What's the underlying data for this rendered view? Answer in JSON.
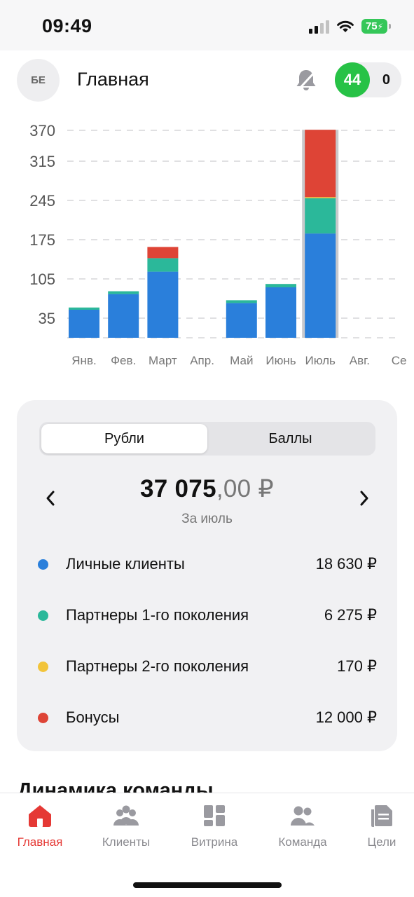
{
  "status_bar": {
    "time": "09:49",
    "battery": "75"
  },
  "header": {
    "avatar_initials": "БЕ",
    "title": "Главная",
    "counter_green": "44",
    "counter_gray": "0"
  },
  "colors": {
    "personal": "#2a7fdb",
    "partners1": "#2bb89a",
    "partners2": "#f2c43a",
    "bonus": "#de4436",
    "active_tab": "#e53935",
    "badge_green": "#27c246"
  },
  "chart_data": {
    "type": "bar",
    "stacked": true,
    "categories": [
      "Янв.",
      "Фев.",
      "Март",
      "Апр.",
      "Май",
      "Июнь",
      "Июль",
      "Авг.",
      "Се"
    ],
    "series": [
      {
        "name": "Личные клиенты",
        "color": "#2a7fdb",
        "values": [
          50,
          78,
          118,
          0,
          62,
          90,
          186,
          0,
          0
        ]
      },
      {
        "name": "Партнеры 1-го поколения",
        "color": "#2bb89a",
        "values": [
          4,
          5,
          24,
          0,
          5,
          6,
          63,
          0,
          0
        ]
      },
      {
        "name": "Партнеры 2-го поколения",
        "color": "#f2c43a",
        "values": [
          0,
          0,
          0,
          0,
          0,
          0,
          2,
          0,
          0
        ]
      },
      {
        "name": "Бонусы",
        "color": "#de4436",
        "values": [
          0,
          0,
          20,
          0,
          0,
          0,
          120,
          0,
          0
        ]
      }
    ],
    "yticks": [
      35,
      105,
      175,
      245,
      315,
      370
    ],
    "ylim": [
      0,
      370
    ],
    "selected_category": "Июль",
    "grid": true
  },
  "summary": {
    "tabs": [
      "Рубли",
      "Баллы"
    ],
    "active_tab": "Рубли",
    "amount_int": "37 075",
    "amount_frac": ",00 ₽",
    "period": "За июль",
    "items": [
      {
        "label": "Личные клиенты",
        "value": "18 630 ₽",
        "color": "#2a7fdb"
      },
      {
        "label": "Партнеры 1-го поколения",
        "value": "6 275 ₽",
        "color": "#2bb89a"
      },
      {
        "label": "Партнеры 2-го поколения",
        "value": "170 ₽",
        "color": "#f2c43a"
      },
      {
        "label": "Бонусы",
        "value": "12 000 ₽",
        "color": "#de4436"
      }
    ]
  },
  "next_section_title": "Динамика команды",
  "tabbar": {
    "items": [
      {
        "label": "Главная",
        "icon": "home-icon"
      },
      {
        "label": "Клиенты",
        "icon": "clients-icon"
      },
      {
        "label": "Витрина",
        "icon": "showcase-icon"
      },
      {
        "label": "Команда",
        "icon": "team-icon"
      },
      {
        "label": "Цели",
        "icon": "goals-icon"
      }
    ],
    "active": "Главная"
  }
}
